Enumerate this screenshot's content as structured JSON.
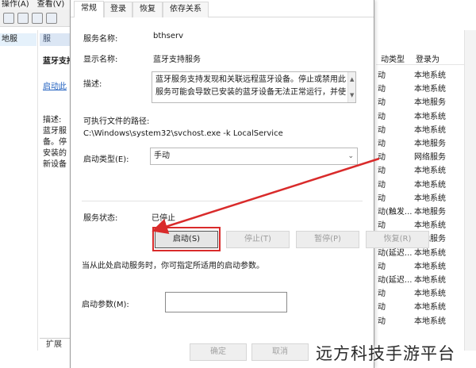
{
  "background": {
    "menu": [
      "操作(A)",
      "查看(V)"
    ],
    "tree_selected": "地服",
    "detail": {
      "header": "服",
      "title": "蓝牙支持",
      "start_link": "启动此",
      "desc_label": "描述:",
      "desc_lines": [
        "蓝牙服",
        "备。停",
        "安装的",
        "新设备"
      ]
    },
    "extend_tab": "扩展",
    "columns": {
      "startup_type": "动类型",
      "login_as": "登录为"
    },
    "rows": [
      {
        "type": "动",
        "login": "本地系统"
      },
      {
        "type": "动",
        "login": "本地系统"
      },
      {
        "type": "动",
        "login": "本地服务"
      },
      {
        "type": "动",
        "login": "本地系统"
      },
      {
        "type": "动",
        "login": "本地系统"
      },
      {
        "type": "动",
        "login": "本地服务"
      },
      {
        "type": "动",
        "login": "网络服务"
      },
      {
        "type": "动",
        "login": "本地系统"
      },
      {
        "type": "动",
        "login": "本地系统"
      },
      {
        "type": "动",
        "login": "本地系统"
      },
      {
        "type": "动(触发...",
        "login": "本地服务"
      },
      {
        "type": "动",
        "login": "本地系统"
      },
      {
        "type": "动(触发...",
        "login": "本地服务"
      },
      {
        "type": "动(延迟...",
        "login": "本地系统"
      },
      {
        "type": "动",
        "login": "本地系统"
      },
      {
        "type": "动(延迟...",
        "login": "本地系统"
      },
      {
        "type": "动",
        "login": "本地系统"
      },
      {
        "type": "动",
        "login": "本地系统"
      },
      {
        "type": "动",
        "login": "本地系统"
      }
    ]
  },
  "dialog": {
    "tabs": [
      "常规",
      "登录",
      "恢复",
      "依存关系"
    ],
    "service_name_label": "服务名称:",
    "service_name": "bthserv",
    "display_name_label": "显示名称:",
    "display_name": "蓝牙支持服务",
    "description_label": "描述:",
    "description": "蓝牙服务支持发现和关联远程蓝牙设备。停止或禁用此服务可能会导致已安装的蓝牙设备无法正常运行，并使",
    "exe_path_label": "可执行文件的路径:",
    "exe_path": "C:\\Windows\\system32\\svchost.exe -k LocalService",
    "startup_type_label": "启动类型(E):",
    "startup_type": "手动",
    "status_label": "服务状态:",
    "status": "已停止",
    "buttons": {
      "start": "启动(S)",
      "stop": "停止(T)",
      "pause": "暂停(P)",
      "resume": "恢复(R)"
    },
    "hint": "当从此处启动服务时，你可指定所适用的启动参数。",
    "params_label": "启动参数(M):",
    "params_value": "",
    "footer": {
      "ok": "确定",
      "cancel": "取消"
    }
  },
  "annotation_color": "#d92b2b",
  "watermark": "远方科技手游平台"
}
